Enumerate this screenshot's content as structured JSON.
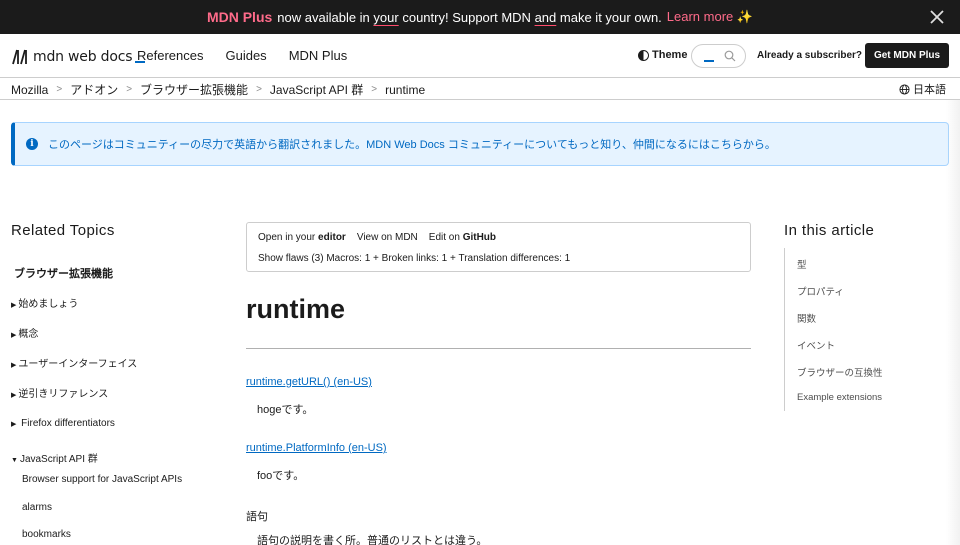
{
  "banner": {
    "brand": "MDN Plus",
    "text_1": "now available in",
    "text_your": "your",
    "text_2": "country! Support MDN",
    "text_and": "and",
    "text_3": "make it your own.",
    "learn_more": "Learn more ✨"
  },
  "header": {
    "logo_text": "mdn web docs",
    "nav": [
      "References",
      "Guides",
      "MDN Plus"
    ],
    "theme_label": "Theme",
    "subscriber_text": "Already a subscriber?",
    "get_plus_label": "Get MDN Plus"
  },
  "breadcrumb": {
    "items": [
      "Mozilla",
      "アドオン",
      "ブラウザー拡張機能",
      "JavaScript API 群",
      "runtime"
    ],
    "language": "日本語"
  },
  "notice": {
    "message": "このページはコミュニティーの尽力で英語から翻訳されました。MDN Web Docs コミュニティーについてもっと知り、仲間になるにはこちらから。"
  },
  "sidebar": {
    "title": "Related Topics",
    "section": "ブラウザー拡張機能",
    "items": [
      {
        "label": "始めましょう",
        "state": "collapsed"
      },
      {
        "label": "概念",
        "state": "collapsed"
      },
      {
        "label": "ユーザーインターフェイス",
        "state": "collapsed"
      },
      {
        "label": "逆引きリファレンス",
        "state": "collapsed"
      },
      {
        "label": "Firefox differentiators",
        "state": "collapsed"
      },
      {
        "label": "JavaScript API 群",
        "state": "expanded"
      }
    ],
    "subitems": [
      "Browser support for JavaScript APIs",
      "alarms",
      "bookmarks"
    ]
  },
  "toolbar": {
    "open_editor_prefix": "Open in your",
    "open_editor_strong": "editor",
    "view_mdn": "View on MDN",
    "edit_prefix": "Edit on",
    "edit_strong": "GitHub",
    "flaws": "Show flaws (3) Macros: 1 + Broken links: 1 + Translation differences: 1"
  },
  "article": {
    "title": "runtime",
    "entries": [
      {
        "term": "runtime.getURL() (en-US)",
        "desc": "hogeです。",
        "link": true
      },
      {
        "term": "runtime.PlatformInfo (en-US)",
        "desc": "fooです。",
        "link": true
      },
      {
        "term": "語句",
        "desc": "語句の説明を書く所。普通のリストとは違う。",
        "link": false
      }
    ]
  },
  "toc": {
    "title": "In this article",
    "items": [
      "型",
      "プロパティ",
      "関数",
      "イベント",
      "ブラウザーの互換性",
      "Example extensions"
    ]
  },
  "colors": {
    "banner_bg": "#1b1b1b",
    "brand_pink": "#ff6b8a",
    "link_blue": "#0069c2",
    "notice_bg": "#e6f3ff"
  },
  "icons": [
    "close-icon",
    "mdn-logo-icon",
    "theme-icon",
    "search-icon",
    "globe-icon",
    "info-icon",
    "chevron-right-icon"
  ]
}
